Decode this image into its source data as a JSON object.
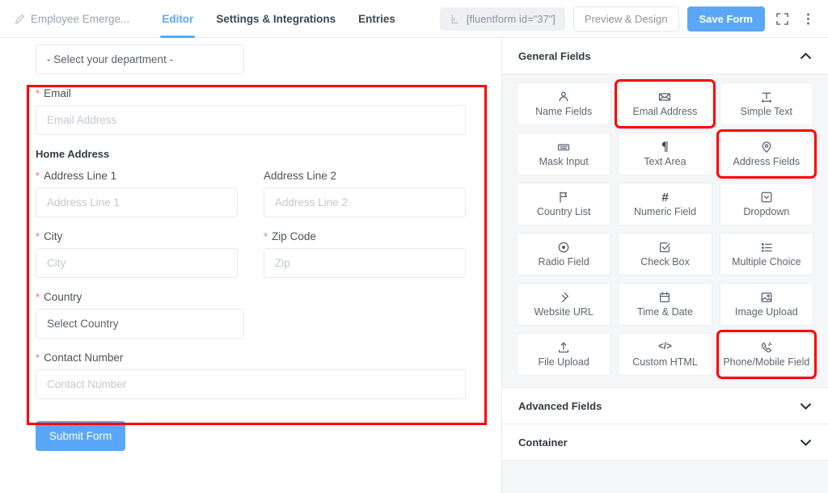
{
  "header": {
    "form_title": "Employee Emerge...",
    "edit_icon": "pencil-icon",
    "tabs": [
      {
        "label": "Editor",
        "active": true
      },
      {
        "label": "Settings & Integrations",
        "active": false
      },
      {
        "label": "Entries",
        "active": false
      }
    ],
    "shortcode": "[fluentform id=\"37\"]",
    "shortcode_icon": "shortcode-bracket-icon",
    "preview_label": "Preview & Design",
    "save_label": "Save Form",
    "fullscreen_icon": "fullscreen-icon",
    "more_icon": "vertical-dots-icon",
    "accent_color": "#5ba7f7"
  },
  "form": {
    "department": {
      "name": "department-select",
      "value": "- Select your department -"
    },
    "email": {
      "label": "Email",
      "required": true,
      "placeholder": "Email Address"
    },
    "address_section_title": "Home Address",
    "address_line1": {
      "label": "Address Line 1",
      "required": true,
      "placeholder": "Address Line 1"
    },
    "address_line2": {
      "label": "Address Line 2",
      "required": false,
      "placeholder": "Address Line 2"
    },
    "city": {
      "label": "City",
      "required": true,
      "placeholder": "City"
    },
    "zip": {
      "label": "Zip Code",
      "required": true,
      "placeholder": "Zip"
    },
    "country": {
      "label": "Country",
      "required": true,
      "value": "Select Country"
    },
    "contact_number": {
      "label": "Contact Number",
      "required": true,
      "placeholder": "Contact Number"
    },
    "submit_label": "Submit Form",
    "required_marker": "*"
  },
  "sidebar": {
    "panels": [
      {
        "title": "General Fields",
        "expanded": true,
        "chevron": "chevron-up-icon"
      },
      {
        "title": "Advanced Fields",
        "expanded": false,
        "chevron": "chevron-down-icon"
      },
      {
        "title": "Container",
        "expanded": false,
        "chevron": "chevron-down-icon"
      }
    ],
    "general_fields": [
      {
        "label": "Name Fields",
        "icon": "user-icon",
        "highlighted": false
      },
      {
        "label": "Email Address",
        "icon": "envelope-icon",
        "highlighted": true
      },
      {
        "label": "Simple Text",
        "icon": "text-width-icon",
        "highlighted": false
      },
      {
        "label": "Mask Input",
        "icon": "keyboard-icon",
        "highlighted": false
      },
      {
        "label": "Text Area",
        "icon": "paragraph-icon",
        "highlighted": false
      },
      {
        "label": "Address Fields",
        "icon": "map-pin-icon",
        "highlighted": true
      },
      {
        "label": "Country List",
        "icon": "flag-icon",
        "highlighted": false
      },
      {
        "label": "Numeric Field",
        "icon": "hash-icon",
        "highlighted": false
      },
      {
        "label": "Dropdown",
        "icon": "dropdown-icon",
        "highlighted": false
      },
      {
        "label": "Radio Field",
        "icon": "radio-icon",
        "highlighted": false
      },
      {
        "label": "Check Box",
        "icon": "checkbox-icon",
        "highlighted": false
      },
      {
        "label": "Multiple Choice",
        "icon": "list-icon",
        "highlighted": false
      },
      {
        "label": "Website URL",
        "icon": "link-icon",
        "highlighted": false
      },
      {
        "label": "Time & Date",
        "icon": "calendar-icon",
        "highlighted": false
      },
      {
        "label": "Image Upload",
        "icon": "image-icon",
        "highlighted": false
      },
      {
        "label": "File Upload",
        "icon": "upload-icon",
        "highlighted": false
      },
      {
        "label": "Custom HTML",
        "icon": "code-icon",
        "highlighted": false
      },
      {
        "label": "Phone/Mobile Field",
        "icon": "phone-icon",
        "highlighted": true
      }
    ]
  },
  "annotations": {
    "highlight_color": "#ff0000",
    "boxes": [
      {
        "name": "form-fields-highlight"
      },
      {
        "name": "email-address-card-highlight"
      },
      {
        "name": "address-fields-card-highlight"
      },
      {
        "name": "phone-mobile-card-highlight"
      }
    ]
  }
}
